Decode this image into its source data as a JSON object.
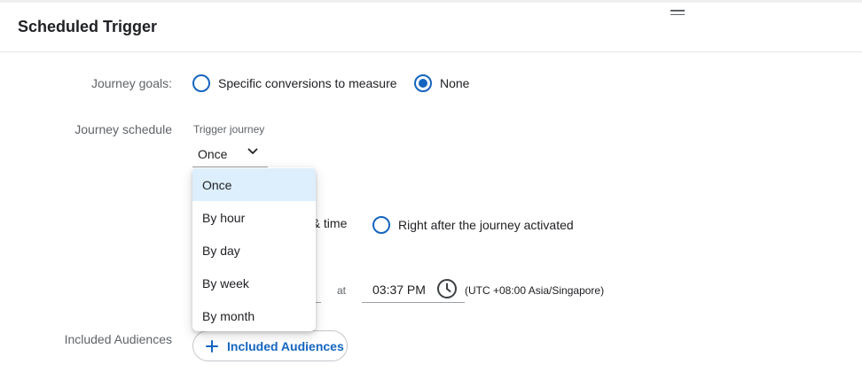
{
  "header": {
    "title": "Scheduled Trigger"
  },
  "journey_goals": {
    "label": "Journey goals:",
    "options": [
      {
        "label": "Specific conversions to measure",
        "checked": false
      },
      {
        "label": "None",
        "checked": true
      }
    ]
  },
  "journey_schedule": {
    "label": "Journey schedule",
    "trigger": {
      "label": "Trigger journey",
      "selected": "Once",
      "options": [
        "Once",
        "By hour",
        "By day",
        "By week",
        "By month"
      ]
    },
    "start": {
      "options": [
        {
          "label": "e & time",
          "checked": false
        },
        {
          "label": "Right after the journey activated",
          "checked": false
        }
      ]
    },
    "datetime": {
      "at_label": "at",
      "time": "03:37 PM",
      "timezone": "(UTC +08:00 Asia/Singapore)"
    }
  },
  "audiences": {
    "label": "Included Audiences",
    "button_label": "Included Audiences"
  },
  "colors": {
    "accent": "#1565c0",
    "menu_selected_bg": "#ddeefc",
    "label_gray": "#5f6368"
  }
}
